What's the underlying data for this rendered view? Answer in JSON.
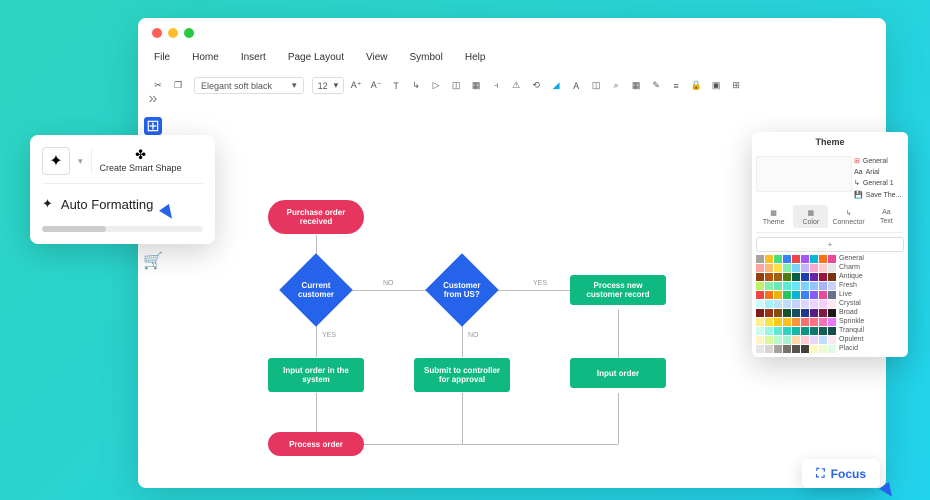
{
  "menu": {
    "file": "File",
    "home": "Home",
    "insert": "Insert",
    "layout": "Page Layout",
    "view": "View",
    "symbol": "Symbol",
    "help": "Help"
  },
  "toolbar": {
    "font": "Elegant soft black",
    "size": "12"
  },
  "popup": {
    "smart_shape": "Create Smart Shape",
    "auto_format": "Auto Formatting"
  },
  "flow": {
    "purchase": "Purchase order received",
    "current": "Current customer",
    "us": "Customer from US?",
    "process_new": "Process new customer record",
    "input_sys": "Input order in the system",
    "submit": "Submit to controller for approval",
    "input_order": "Input order",
    "process_order": "Process order",
    "no": "NO",
    "yes": "YES"
  },
  "theme": {
    "title": "Theme",
    "general": "General",
    "arial": "Arial",
    "general1": "General 1",
    "save": "Save The...",
    "tabs": {
      "theme": "Theme",
      "color": "Color",
      "connector": "Connector",
      "text": "Text"
    },
    "palettes": [
      "General",
      "Charm",
      "Antique",
      "Fresh",
      "Live",
      "Crystal",
      "Broad",
      "Sprinkle",
      "Tranquil",
      "Opulent",
      "Placid"
    ]
  },
  "focus": "Focus"
}
